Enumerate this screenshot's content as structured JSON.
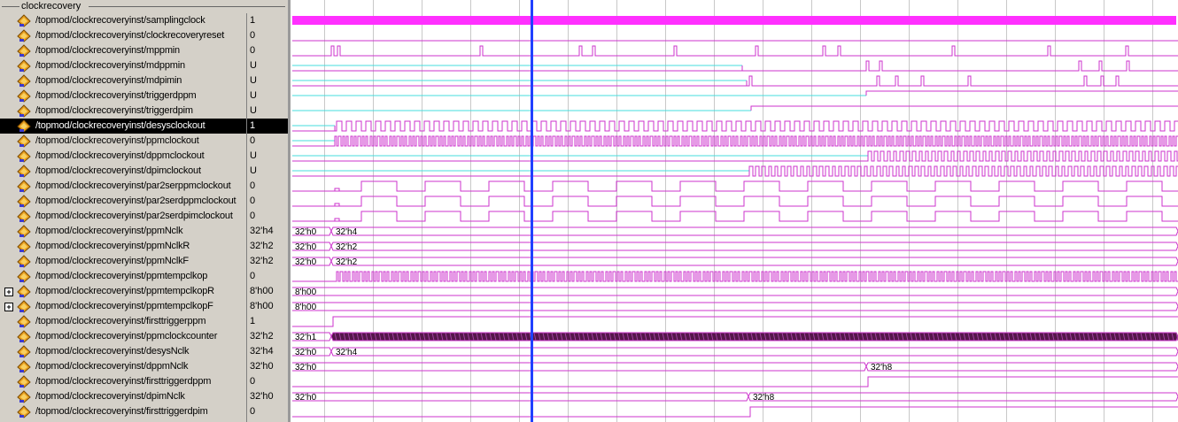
{
  "group_name": "clockrecovery",
  "colors": {
    "wave": "#cc33cc",
    "undefined": "#44dddd",
    "cursor": "#2040ff",
    "grid": "#c8c8c8",
    "bus_fill": "#55164a"
  },
  "signals": [
    {
      "name": "/topmod/clockrecoveryinst/samplingclock",
      "value": "1",
      "icon": "wave-icon"
    },
    {
      "name": "/topmod/clockrecoveryinst/clockrecoveryreset",
      "value": "0",
      "icon": "wave-icon"
    },
    {
      "name": "/topmod/clockrecoveryinst/mppmin",
      "value": "0",
      "icon": "wave-icon"
    },
    {
      "name": "/topmod/clockrecoveryinst/mdppmin",
      "value": "U",
      "icon": "wave-icon"
    },
    {
      "name": "/topmod/clockrecoveryinst/mdpimin",
      "value": "U",
      "icon": "wave-icon"
    },
    {
      "name": "/topmod/clockrecoveryinst/triggerdppm",
      "value": "U",
      "icon": "wave-icon"
    },
    {
      "name": "/topmod/clockrecoveryinst/triggerdpim",
      "value": "U",
      "icon": "wave-icon"
    },
    {
      "name": "/topmod/clockrecoveryinst/desysclockout",
      "value": "1",
      "icon": "wave-icon",
      "selected": true
    },
    {
      "name": "/topmod/clockrecoveryinst/ppmclockout",
      "value": "0",
      "icon": "wave-icon"
    },
    {
      "name": "/topmod/clockrecoveryinst/dppmclockout",
      "value": "U",
      "icon": "wave-icon"
    },
    {
      "name": "/topmod/clockrecoveryinst/dpimclockout",
      "value": "U",
      "icon": "wave-icon"
    },
    {
      "name": "/topmod/clockrecoveryinst/par2serppmclockout",
      "value": "0",
      "icon": "wave-icon"
    },
    {
      "name": "/topmod/clockrecoveryinst/par2serdppmclockout",
      "value": "0",
      "icon": "wave-icon"
    },
    {
      "name": "/topmod/clockrecoveryinst/par2serdpimclockout",
      "value": "0",
      "icon": "wave-icon"
    },
    {
      "name": "/topmod/clockrecoveryinst/ppmNclk",
      "value": "32'h4",
      "icon": "wave-icon"
    },
    {
      "name": "/topmod/clockrecoveryinst/ppmNclkR",
      "value": "32'h2",
      "icon": "wave-icon"
    },
    {
      "name": "/topmod/clockrecoveryinst/ppmNclkF",
      "value": "32'h2",
      "icon": "wave-icon"
    },
    {
      "name": "/topmod/clockrecoveryinst/ppmtempclkop",
      "value": "0",
      "icon": "wave-icon"
    },
    {
      "name": "/topmod/clockrecoveryinst/ppmtempclkopR",
      "value": "8'h00",
      "icon": "wave-icon",
      "expandable": true,
      "expand_label": "+"
    },
    {
      "name": "/topmod/clockrecoveryinst/ppmtempclkopF",
      "value": "8'h00",
      "icon": "wave-icon",
      "expandable": true,
      "expand_label": "+"
    },
    {
      "name": "/topmod/clockrecoveryinst/firsttriggerppm",
      "value": "1",
      "icon": "wave-icon"
    },
    {
      "name": "/topmod/clockrecoveryinst/ppmclockcounter",
      "value": "32'h2",
      "icon": "wave-icon"
    },
    {
      "name": "/topmod/clockrecoveryinst/desysNclk",
      "value": "32'h4",
      "icon": "wave-icon"
    },
    {
      "name": "/topmod/clockrecoveryinst/dppmNclk",
      "value": "32'h0",
      "icon": "wave-icon"
    },
    {
      "name": "/topmod/clockrecoveryinst/firsttriggerdppm",
      "value": "0",
      "icon": "wave-icon"
    },
    {
      "name": "/topmod/clockrecoveryinst/dpimNclk",
      "value": "32'h0",
      "icon": "wave-icon"
    },
    {
      "name": "/topmod/clockrecoveryinst/firsttriggerdpim",
      "value": "0",
      "icon": "wave-icon"
    }
  ],
  "bus_labels": {
    "ppmNclk": [
      "32'h0",
      "32'h4"
    ],
    "ppmNclkR": [
      "32'h0",
      "32'h2"
    ],
    "ppmNclkF": [
      "32'h0",
      "32'h2"
    ],
    "ppmtempclkopR": [
      "8'h00"
    ],
    "ppmtempclkopF": [
      "8'h00"
    ],
    "ppmclockcounter": [
      "32'h1"
    ],
    "desysNclk": [
      "32'h0",
      "32'h4"
    ],
    "dppmNclk": [
      "32'h0",
      "32'h8"
    ],
    "dpimNclk": [
      "32'h0",
      "32'h8"
    ]
  }
}
